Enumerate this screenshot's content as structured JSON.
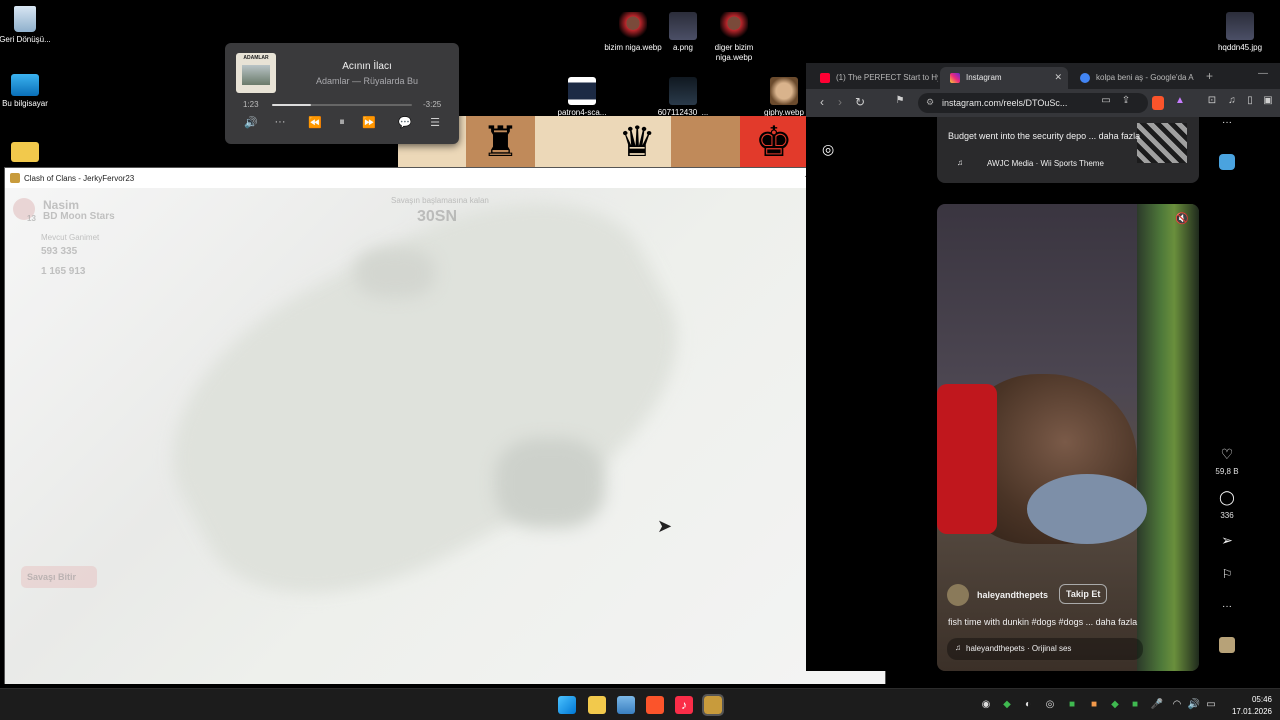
{
  "desktop": {
    "icons_left": [
      {
        "label": "Geri Dönüşü...",
        "icon": "recycle-bin-icon"
      },
      {
        "label": "Bu bilgisayar",
        "icon": "computer-icon"
      },
      {
        "label": "",
        "icon": "folder-icon"
      }
    ],
    "icons_top": [
      {
        "label": "bizim niga.webp"
      },
      {
        "label": "a.png"
      },
      {
        "label": "diger bizim niga.webp"
      },
      {
        "label": "patron4-sca..."
      },
      {
        "label": "607112430_..."
      },
      {
        "label": "giphy.webp"
      },
      {
        "label": "hqddn45.jpg"
      }
    ],
    "chess_pieces": [
      "",
      "♜",
      "",
      "♛",
      "",
      "♚"
    ]
  },
  "player": {
    "album_band": "ADAMLAR",
    "title": "Acının İlacı",
    "artist": "Adamlar — Rüyalarda Bu",
    "elapsed": "1:23",
    "remaining": "-3:25",
    "progress": 0.28,
    "controls": {
      "volume": "🔊",
      "more": "···",
      "prev": "⏪",
      "pause": "⏸",
      "next": "⏩",
      "lyrics": "💬",
      "queue": "☰"
    }
  },
  "game_window": {
    "title": "Clash of Clans - JerkyFervor23",
    "minimize": "—",
    "maximize": "☐",
    "close": "✕",
    "hud": {
      "player_name": "Nasim",
      "level": "13",
      "base_name": "BD Moon Stars",
      "loot_label": "Mevcut Ganimet",
      "loot_value": "593 335",
      "loot_value2": "1 165 913",
      "timer_label": "Savaşın başlamasına kalan",
      "timer_value": "30SN",
      "attack_button": "Savaşı Bitir"
    }
  },
  "browser": {
    "tabs": [
      {
        "label": "(1) The PERFECT Start to Hy",
        "color": "#ff0033"
      },
      {
        "label": "Instagram",
        "color": "#d6249f"
      },
      {
        "label": "kolpa beni aş - Google'da A",
        "color": "#4285f4"
      }
    ],
    "new_tab": "+",
    "minimize": "—",
    "url": "instagram.com/reels/DTOuSc...",
    "reel_top": {
      "caption": "Budget went into the security depo ... daha fazla",
      "audio": "AWJC Media · Wii Sports Theme"
    },
    "reel_main": {
      "username": "haleyandthepets",
      "follow": "Takip Et",
      "caption": "fish time with dunkin #dogs #dogs ... daha fazla",
      "audio": "haleyandthepets · Orijinal ses",
      "likes": "59,8 B",
      "comments": "336"
    }
  },
  "taskbar": {
    "time": "05:46",
    "date": "17.01.2026"
  }
}
